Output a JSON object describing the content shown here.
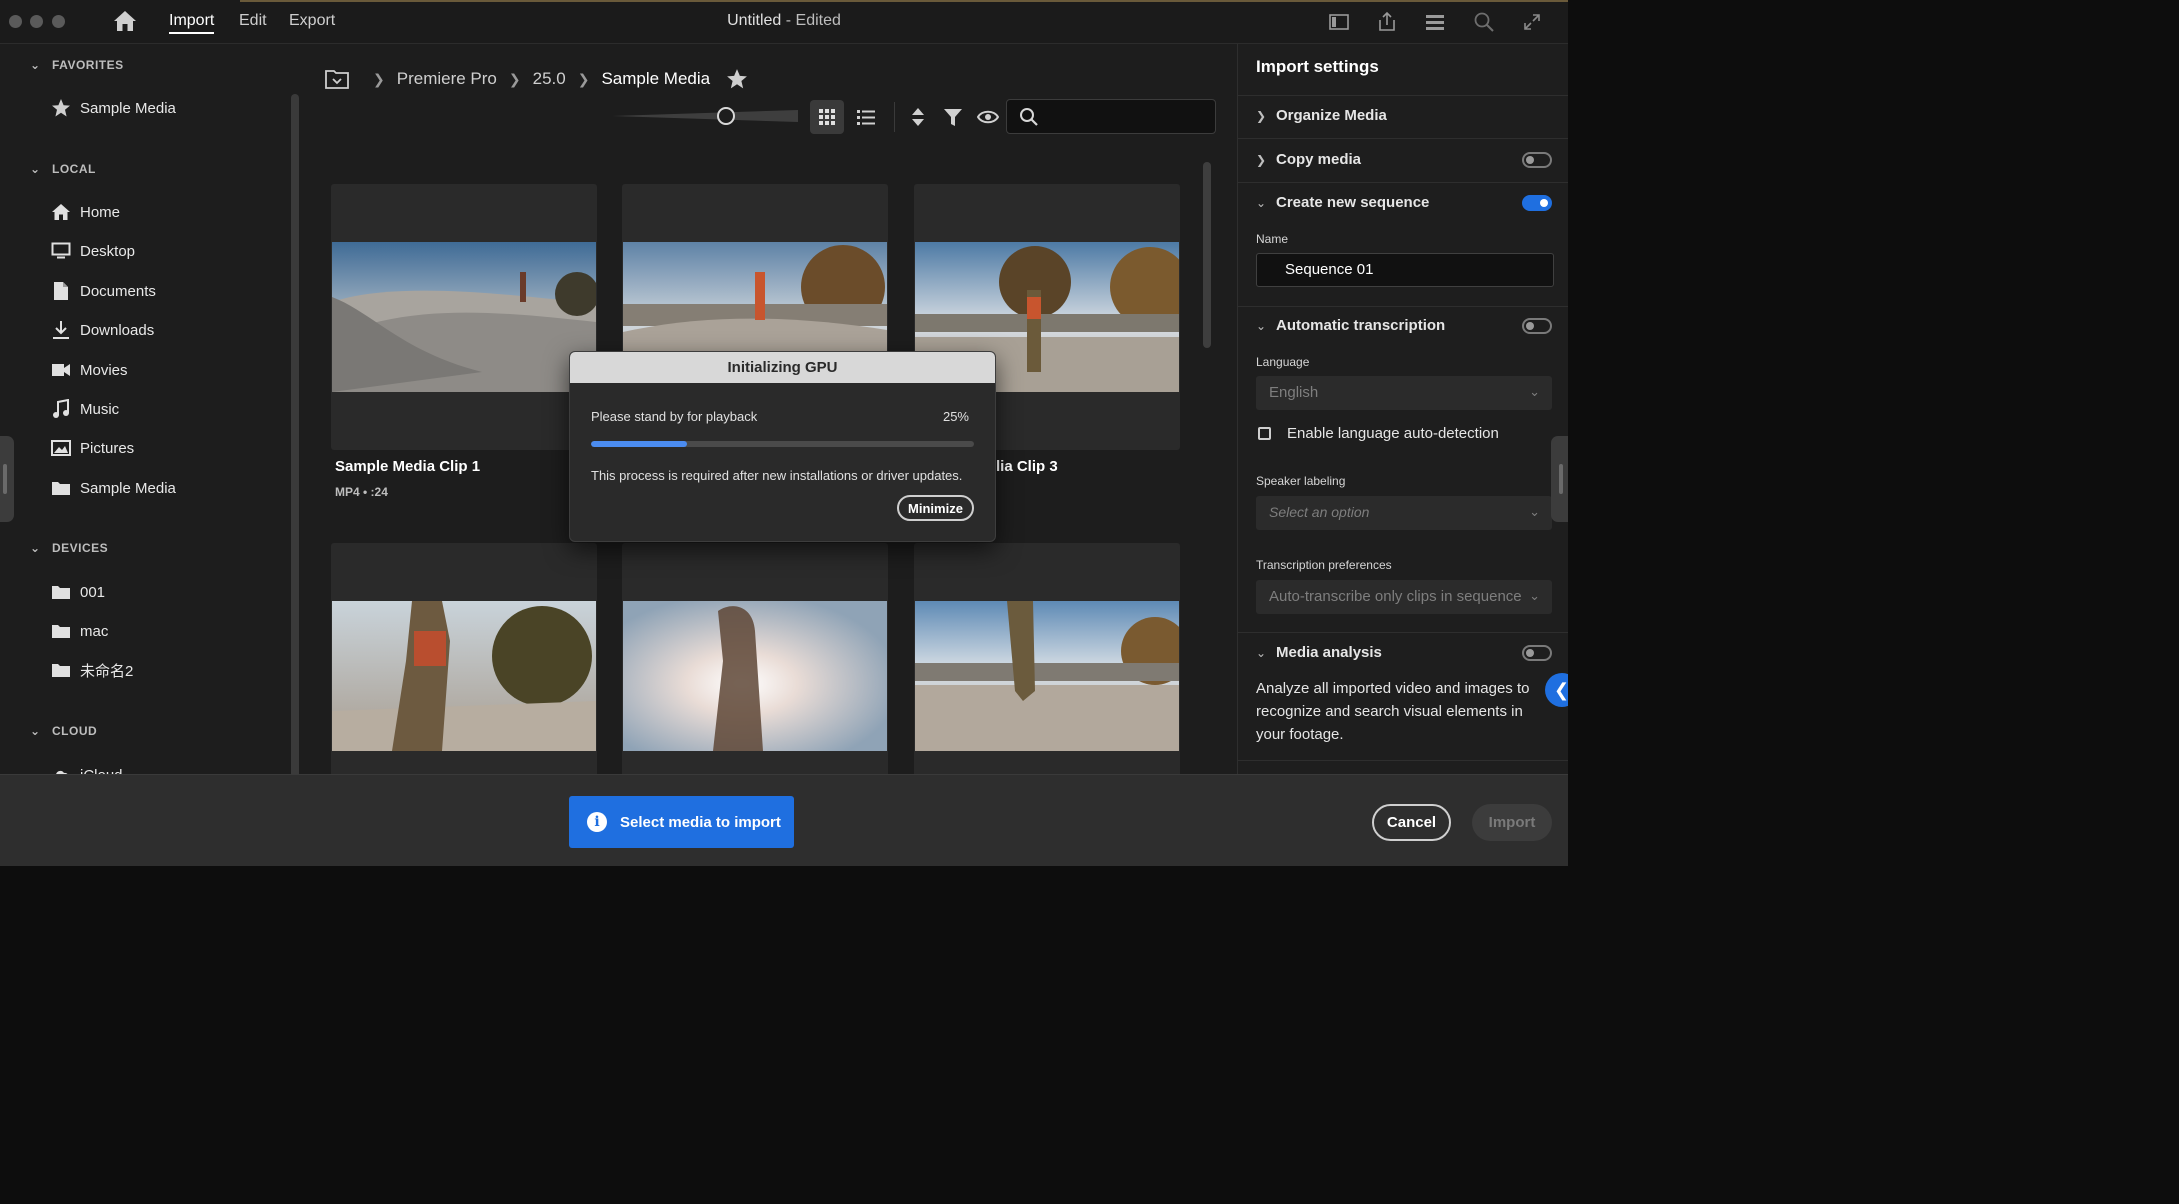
{
  "titlebar": {
    "menu": [
      "Import",
      "Edit",
      "Export"
    ],
    "doc_title": "Untitled",
    "doc_status": "- Edited"
  },
  "sidebar": {
    "favorites_label": "FAVORITES",
    "favorites": [
      {
        "label": "Sample Media",
        "icon": "star-icon"
      }
    ],
    "local_label": "LOCAL",
    "local": [
      {
        "label": "Home",
        "icon": "home-icon"
      },
      {
        "label": "Desktop",
        "icon": "desktop-icon"
      },
      {
        "label": "Documents",
        "icon": "document-icon"
      },
      {
        "label": "Downloads",
        "icon": "download-icon"
      },
      {
        "label": "Movies",
        "icon": "video-camera-icon"
      },
      {
        "label": "Music",
        "icon": "music-note-icon"
      },
      {
        "label": "Pictures",
        "icon": "picture-icon"
      },
      {
        "label": "Sample Media",
        "icon": "folder-icon"
      }
    ],
    "devices_label": "DEVICES",
    "devices": [
      {
        "label": "001",
        "icon": "folder-icon"
      },
      {
        "label": "mac",
        "icon": "folder-icon"
      },
      {
        "label": "未命名2",
        "icon": "folder-icon"
      }
    ],
    "cloud_label": "CLOUD",
    "cloud": [
      {
        "label": "iCloud",
        "icon": "cloud-icon"
      }
    ]
  },
  "breadcrumb": [
    "Premiere Pro",
    "25.0",
    "Sample Media"
  ],
  "media": [
    {
      "title": "Sample Media Clip 1",
      "meta": "MP4 • :24"
    },
    {
      "title": "",
      "meta": ""
    },
    {
      "title": "lia Clip 3",
      "meta": ""
    },
    {
      "title": "",
      "meta": ""
    },
    {
      "title": "",
      "meta": ""
    },
    {
      "title": "",
      "meta": ""
    }
  ],
  "import_settings": {
    "title": "Import settings",
    "organize_media": "Organize Media",
    "copy_media": "Copy media",
    "create_sequence": "Create new sequence",
    "name_label": "Name",
    "name_value": "Sequence 01",
    "auto_transcription": "Automatic transcription",
    "language_label": "Language",
    "language_value": "English",
    "auto_detect_label": "Enable language auto-detection",
    "speaker_label": "Speaker labeling",
    "speaker_placeholder": "Select an option",
    "transcription_pref_label": "Transcription preferences",
    "transcription_pref_value": "Auto-transcribe only clips in sequence",
    "media_analysis": "Media analysis",
    "media_analysis_desc": "Analyze all imported video and images to recognize and search visual elements in your footage.",
    "toggles": {
      "copy_media": false,
      "create_sequence": true,
      "auto_transcription": false,
      "media_analysis": false
    }
  },
  "dialog": {
    "title": "Initializing GPU",
    "message": "Please stand by for playback",
    "percent_label": "25%",
    "progress": 0.25,
    "note": "This process is required after new installations or driver updates.",
    "minimize": "Minimize"
  },
  "footer": {
    "toast": "Select media to import",
    "cancel": "Cancel",
    "import": "Import"
  },
  "colors": {
    "accent": "#1f6fe0",
    "progress": "#4b8cf0",
    "background": "#1d1d1d"
  }
}
